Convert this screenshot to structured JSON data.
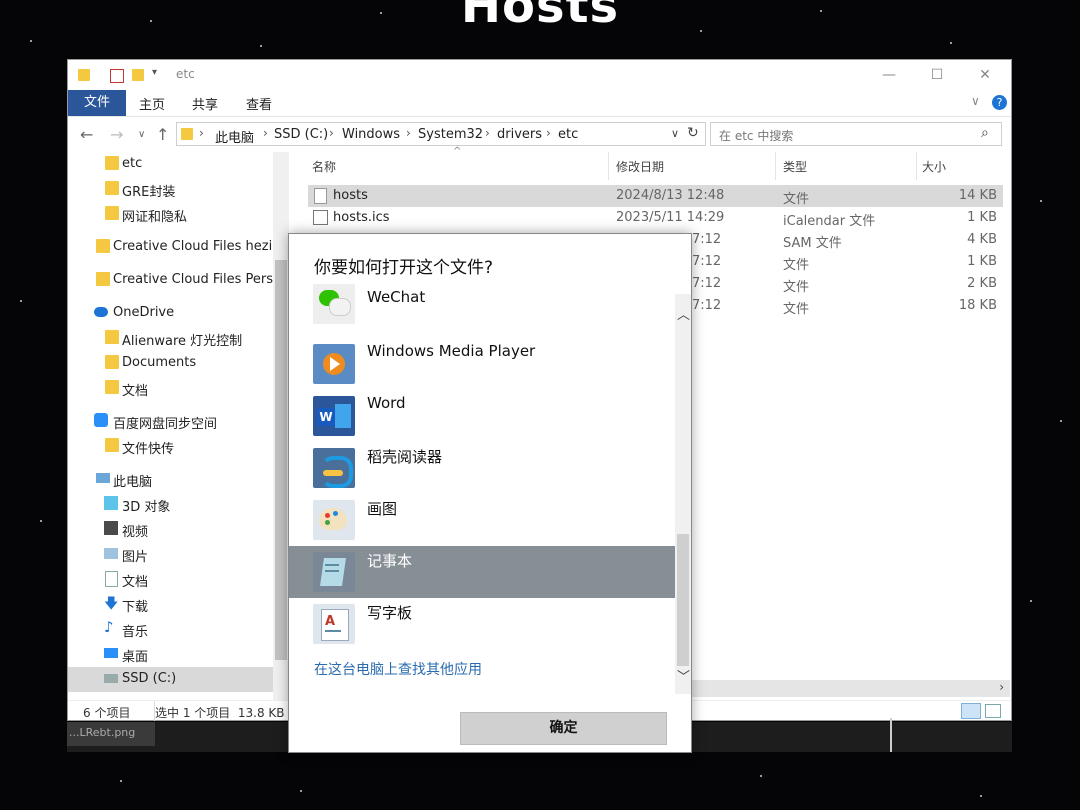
{
  "background": {
    "title": "Hosts"
  },
  "window": {
    "title": "etc",
    "controls": {
      "minimize": "—",
      "maximize": "☐",
      "close": "✕"
    }
  },
  "ribbon": {
    "tabs": [
      "文件",
      "主页",
      "共享",
      "查看"
    ]
  },
  "address": {
    "crumbs": [
      "此电脑",
      "SSD (C:)",
      "Windows",
      "System32",
      "drivers",
      "etc"
    ],
    "search_placeholder": "在 etc 中搜索"
  },
  "nav": {
    "items": [
      {
        "label": "etc",
        "icon": "folder-icon"
      },
      {
        "label": "GRE封装",
        "icon": "folder-icon"
      },
      {
        "label": "网证和隐私",
        "icon": "folder-icon"
      },
      {
        "label": "Creative Cloud Files  hezi.fa",
        "icon": "folder-icon"
      },
      {
        "label": "Creative Cloud Files Person",
        "icon": "folder-icon"
      },
      {
        "label": "OneDrive",
        "icon": "cloud-icon"
      },
      {
        "label": "Alienware 灯光控制",
        "icon": "folder-icon"
      },
      {
        "label": "Documents",
        "icon": "folder-icon"
      },
      {
        "label": "文档",
        "icon": "folder-icon"
      },
      {
        "label": "百度网盘同步空间",
        "icon": "baidu-icon"
      },
      {
        "label": "文件快传",
        "icon": "folder-icon"
      },
      {
        "label": "此电脑",
        "icon": "pc-icon"
      },
      {
        "label": "3D 对象",
        "icon": "cube-icon"
      },
      {
        "label": "视频",
        "icon": "video-icon"
      },
      {
        "label": "图片",
        "icon": "picture-icon"
      },
      {
        "label": "文档",
        "icon": "document-icon"
      },
      {
        "label": "下载",
        "icon": "download-icon"
      },
      {
        "label": "音乐",
        "icon": "music-icon"
      },
      {
        "label": "桌面",
        "icon": "desktop-icon"
      },
      {
        "label": "SSD (C:)",
        "icon": "drive-icon"
      }
    ]
  },
  "files": {
    "columns": [
      "名称",
      "修改日期",
      "类型",
      "大小"
    ],
    "rows": [
      {
        "name": "hosts",
        "date": "2024/8/13 12:48",
        "type": "文件",
        "size": "14 KB"
      },
      {
        "name": "hosts.ics",
        "date": "2023/5/11 14:29",
        "type": "iCalendar 文件",
        "size": "1 KB"
      },
      {
        "name": "",
        "date": "7:12",
        "type": "SAM 文件",
        "size": "4 KB"
      },
      {
        "name": "",
        "date": "7:12",
        "type": "文件",
        "size": "1 KB"
      },
      {
        "name": "",
        "date": "7:12",
        "type": "文件",
        "size": "2 KB"
      },
      {
        "name": "",
        "date": "7:12",
        "type": "文件",
        "size": "18 KB"
      }
    ]
  },
  "status": {
    "count": "6 个项目",
    "selected": "选中 1 个项目  13.8 KB"
  },
  "taskbar": {
    "item": "...LRebt.png"
  },
  "dialog": {
    "title": "你要如何打开这个文件?",
    "apps": [
      {
        "label": "WeChat",
        "icon": "wechat-icon"
      },
      {
        "label": "Windows Media Player",
        "icon": "media-player-icon"
      },
      {
        "label": "Word",
        "icon": "word-icon"
      },
      {
        "label": "稻壳阅读器",
        "icon": "docer-reader-icon"
      },
      {
        "label": "画图",
        "icon": "paint-icon"
      },
      {
        "label": "记事本",
        "icon": "notepad-icon"
      },
      {
        "label": "写字板",
        "icon": "wordpad-icon"
      }
    ],
    "selected_app": "记事本",
    "more_link": "在这台电脑上查找其他应用",
    "ok_label": "确定"
  },
  "colors": {
    "accent": "#2b579a",
    "selection": "#868e96",
    "link": "#2b6cb0"
  }
}
